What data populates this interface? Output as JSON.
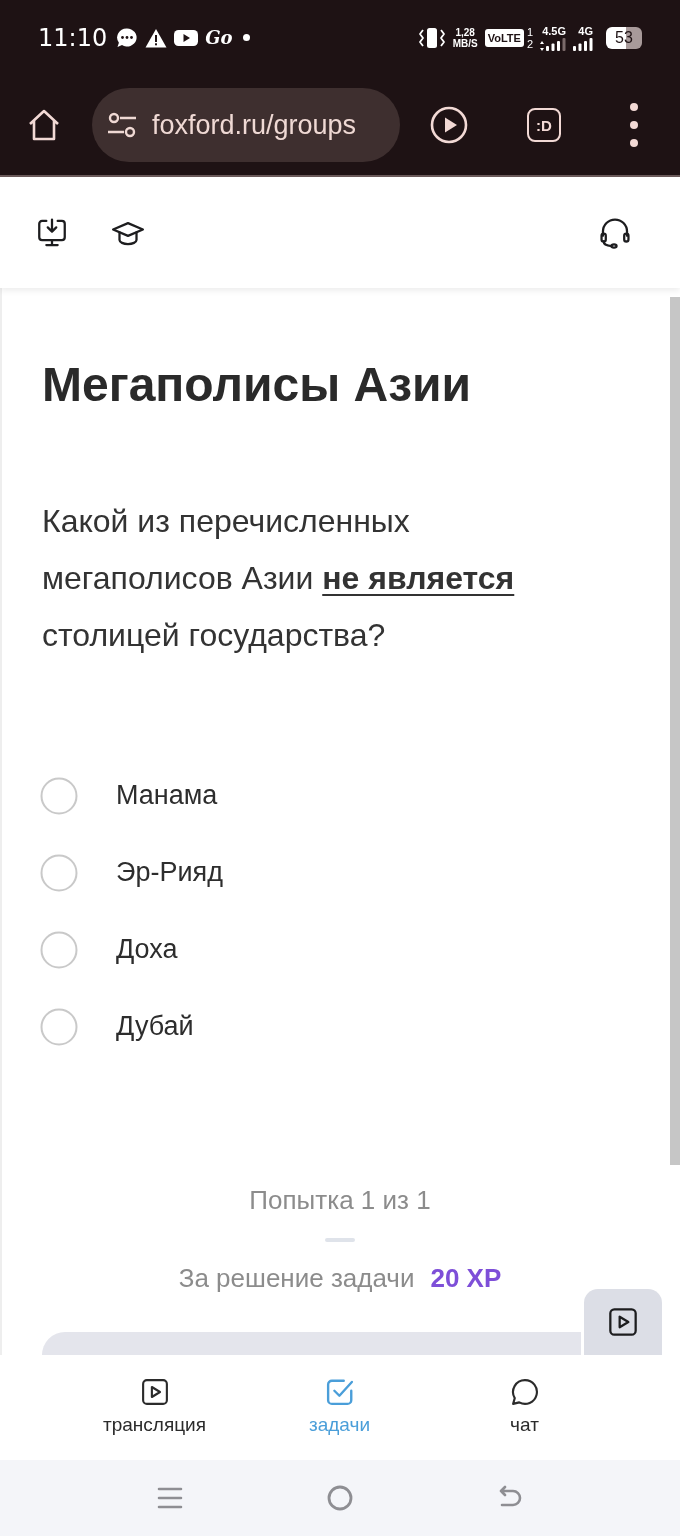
{
  "status_bar": {
    "time": "11:10",
    "app_label": "Go",
    "net_speed": "1,28",
    "net_speed_unit": "MB/S",
    "volte": "VoLTE",
    "sim_1": "1",
    "sim_2": "2",
    "network_1": "4.5G",
    "network_2": "4G",
    "battery": "53"
  },
  "browser": {
    "url": "foxford.ru/groups",
    "extension_label": ":D"
  },
  "task": {
    "title": "Мегаполисы Азии",
    "question": "Какой из перечисленных мегаполисов Азии **не является** столицей государства?",
    "options": [
      {
        "label": "Манама",
        "selected": false
      },
      {
        "label": "Эр-Рияд",
        "selected": false
      },
      {
        "label": "Доха",
        "selected": false
      },
      {
        "label": "Дубай",
        "selected": false
      }
    ],
    "attempt": "Попытка 1 из 1",
    "reward_label": "За решение задачи",
    "reward_value": "20 XP"
  },
  "bottom_nav": {
    "tabs": [
      {
        "label": "трансляция",
        "kind": "stream",
        "selected": false
      },
      {
        "label": "задачи",
        "kind": "tasks",
        "selected": true
      },
      {
        "label": "чат",
        "kind": "chat",
        "selected": false
      }
    ]
  }
}
